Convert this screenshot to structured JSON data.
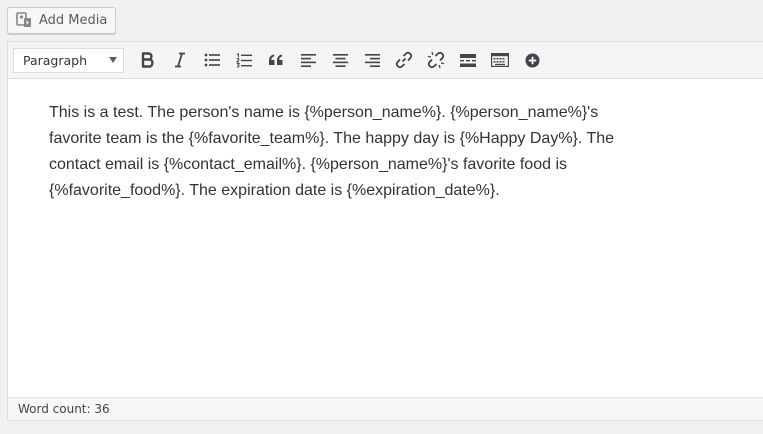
{
  "toolbar_top": {
    "add_media_label": "Add Media",
    "add_media_icon": "media-icon"
  },
  "editor_toolbar": {
    "format_select": "Paragraph",
    "buttons": [
      "bold-icon",
      "italic-icon",
      "bulleted-list-icon",
      "numbered-list-icon",
      "blockquote-icon",
      "align-left-icon",
      "align-center-icon",
      "align-right-icon",
      "link-icon",
      "unlink-icon",
      "read-more-icon",
      "toolbar-toggle-icon",
      "add-icon"
    ]
  },
  "content": {
    "text": "This is a test. The person's name is {%person_name%}. {%person_name%}'s favorite team is the {%favorite_team%}. The happy day is {%Happy Day%}. The contact email is {%contact_email%}. {%person_name%}'s favorite food is {%favorite_food%}. The expiration date is {%expiration_date%}."
  },
  "status": {
    "word_count": "Word count: 36"
  },
  "colors": {
    "background": "#f1f1f1",
    "toolbar_bg": "#f5f5f5",
    "editor_bg": "#ffffff",
    "icon": "#40464d"
  }
}
